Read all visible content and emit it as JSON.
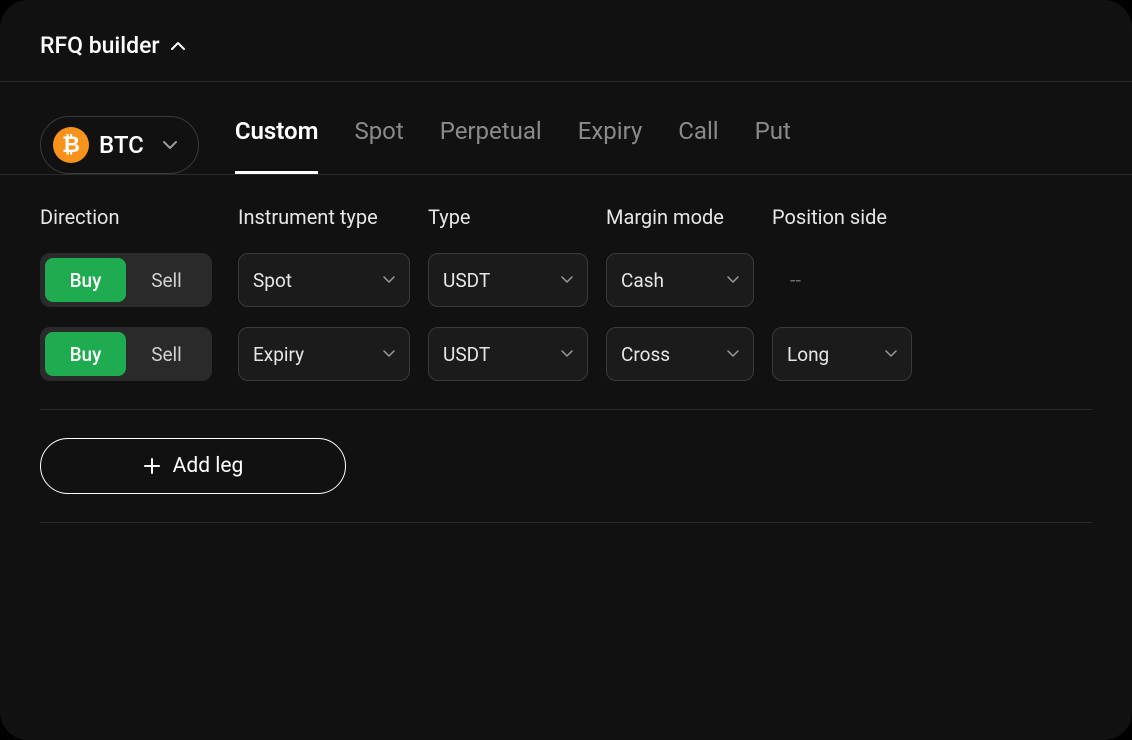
{
  "header": {
    "title": "RFQ builder"
  },
  "asset": {
    "symbol": "BTC",
    "icon_letter": "₿"
  },
  "tabs": [
    {
      "label": "Custom",
      "active": true
    },
    {
      "label": "Spot",
      "active": false
    },
    {
      "label": "Perpetual",
      "active": false
    },
    {
      "label": "Expiry",
      "active": false
    },
    {
      "label": "Call",
      "active": false
    },
    {
      "label": "Put",
      "active": false
    }
  ],
  "columns": {
    "direction": "Direction",
    "instrument_type": "Instrument type",
    "type": "Type",
    "margin_mode": "Margin mode",
    "position_side": "Position side"
  },
  "direction_labels": {
    "buy": "Buy",
    "sell": "Sell"
  },
  "legs": [
    {
      "direction": "Buy",
      "instrument_type": "Spot",
      "type": "USDT",
      "margin_mode": "Cash",
      "position_side": "--"
    },
    {
      "direction": "Buy",
      "instrument_type": "Expiry",
      "type": "USDT",
      "margin_mode": "Cross",
      "position_side": "Long"
    }
  ],
  "add_leg_label": "Add leg"
}
